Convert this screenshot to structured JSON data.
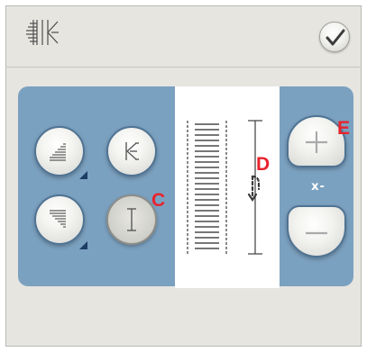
{
  "header": {
    "icon": "stitch-width-position-icon",
    "ok_icon": "checkmark-icon"
  },
  "controls": {
    "buttons": [
      {
        "id": "density-increase",
        "icon": "stitch-density-increase-icon"
      },
      {
        "id": "stitch-width",
        "icon": "stitch-width-icon"
      },
      {
        "id": "density-decrease",
        "icon": "stitch-density-decrease-icon"
      },
      {
        "id": "stitch-length",
        "icon": "stitch-length-icon",
        "state": "pressed"
      }
    ],
    "adjust": {
      "label": "x-",
      "plus_icon": "plus-icon",
      "minus_icon": "minus-icon"
    }
  },
  "preview": {
    "stitch_bars": 24,
    "icon": "stitch-direction-icon"
  },
  "callouts": {
    "c": "C",
    "d": "D",
    "e": "E",
    "color": "#e8232d"
  },
  "colors": {
    "panel": "#7ba1c0",
    "screen": "#e6e5e0",
    "arrow": "#1d3d64"
  }
}
